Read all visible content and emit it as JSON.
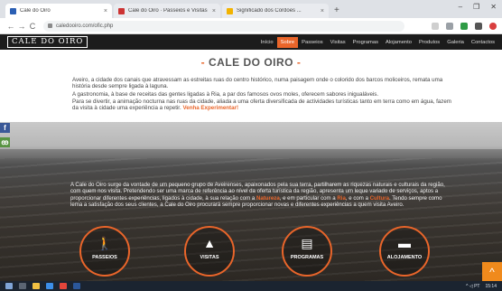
{
  "browser": {
    "tabs": [
      {
        "label": "Cale do Oiro",
        "color": "#2b5fb4"
      },
      {
        "label": "Cale do Oiro · Passeios e Visitas",
        "color": "#cc3333"
      },
      {
        "label": "Significado dos Cordões ...",
        "color": "#f2b300"
      }
    ],
    "new_tab": "+",
    "close_glyph": "×",
    "url": "caledooiro.com/ofic.php",
    "nav": {
      "back": "←",
      "forward": "→",
      "reload": "C"
    },
    "window_controls": [
      "–",
      "❐",
      "✕"
    ]
  },
  "site": {
    "logo": "CALE DO OIRO",
    "menu": [
      "Início",
      "Sobre",
      "Passeios",
      "Visitas",
      "Programas",
      "Alojamento",
      "Produtos",
      "Galeria",
      "Contactos"
    ],
    "active_menu": "Sobre"
  },
  "intro": {
    "dash": "-",
    "title": "CALE DO OIRO",
    "p1": "Aveiro, a cidade dos canais que atravessam as estreitas ruas do centro histórico, numa paisagem onde o colorido dos barcos moliceiros, remata uma história desde sempre ligada à laguna.",
    "p2": "A gastronomia, à base de receitas das gentes ligadas à Ria, a par dos famosos ovos moles, oferecem sabores inigualáveis.",
    "p3": "Para se divertir, a animação nocturna nas ruas da cidade, aliada a uma oferta diversificada de actividades turísticas tanto em terra como em água, fazem da visita à cidade uma experiência a repetir.",
    "p3_highlight": "Venha Experimentar!"
  },
  "hero": {
    "text_start": "A Cale do Oiro surge da vontade de um pequeno grupo de Aveirenses, apaixonados pela sua terra, partilharem as riquezas naturais e culturais da região, com quem nos visita. Pretendendo ser uma marca de referência ao nível da oferta turística da região, apresenta um leque variado de serviços, aptos a proporcionar diferentes experiências, ligados à cidade, à sua relação com a",
    "hl_natureza": "Natureza",
    "text_mid1": ", e em particular com a",
    "hl_ria": "Ria",
    "text_mid2": ", e com a",
    "hl_cultura": "Cultura",
    "text_end": ". Tendo sempre como lema a satisfação dos seus clientes, a Cale do Oiro procurará sempre proporcionar novas e diferentes experiências a quem visita Aveiro.",
    "categories": [
      {
        "label": "PASSEIOS",
        "icon": "🚶"
      },
      {
        "label": "VISITAS",
        "icon": "▲"
      },
      {
        "label": "PROGRAMAS",
        "icon": "▤"
      },
      {
        "label": "ALOJAMENTO",
        "icon": "▬"
      }
    ],
    "social": [
      {
        "glyph": "f",
        "color": "#3b5998"
      },
      {
        "glyph": "ꙭ",
        "color": "#589442"
      }
    ],
    "to_top": "^"
  },
  "taskbar": {
    "time": "15:14",
    "tray": "^ ◁ PT"
  }
}
